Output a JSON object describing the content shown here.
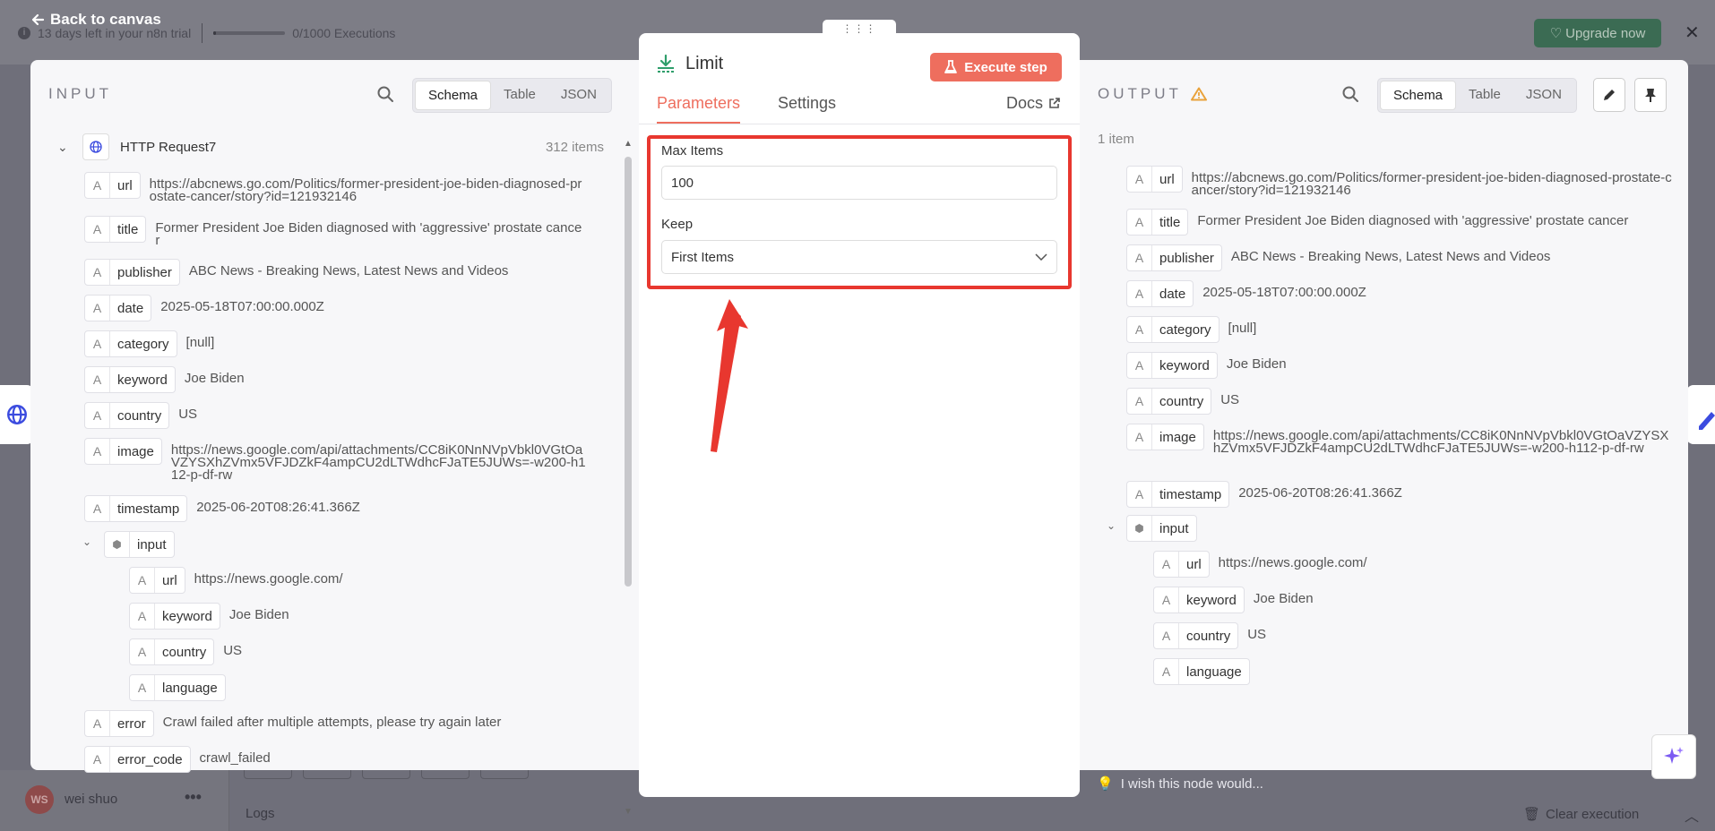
{
  "background": {
    "trial_text": "13 days left in your n8n trial",
    "executions_text": "0/1000 Executions",
    "executions_progress": 0.0,
    "upgrade_label": "Upgrade now",
    "username": "wei shuo",
    "avatar_initials": "WS",
    "logs_label": "Logs",
    "clear_execution_label": "Clear execution"
  },
  "back_link": "Back to canvas",
  "input": {
    "title": "INPUT",
    "view_tabs": [
      "Schema",
      "Table",
      "JSON"
    ],
    "active_tab": "Schema",
    "node_name": "HTTP Request7",
    "item_count": "312 items",
    "fields": [
      {
        "key": "url",
        "value": "https://abcnews.go.com/Politics/former-president-joe-biden-diagnosed-prostate-cancer/story?id=121932146"
      },
      {
        "key": "title",
        "value": "Former President Joe Biden diagnosed with 'aggressive' prostate cancer"
      },
      {
        "key": "publisher",
        "value": "ABC News - Breaking News, Latest News and Videos"
      },
      {
        "key": "date",
        "value": "2025-05-18T07:00:00.000Z"
      },
      {
        "key": "category",
        "value": "[null]"
      },
      {
        "key": "keyword",
        "value": "Joe Biden"
      },
      {
        "key": "country",
        "value": "US"
      },
      {
        "key": "image",
        "value": "https://news.google.com/api/attachments/CC8iK0NnNVpVbkl0VGtOaVZYSXhZVmx5VFJDZkF4ampCU2dLTWdhcFJaTE5JUWs=-w200-h112-p-df-rw"
      },
      {
        "key": "timestamp",
        "value": "2025-06-20T08:26:41.366Z"
      },
      {
        "key": "input",
        "value": ""
      },
      {
        "key": "url",
        "value": "https://news.google.com/"
      },
      {
        "key": "keyword",
        "value": "Joe Biden"
      },
      {
        "key": "country",
        "value": "US"
      },
      {
        "key": "language",
        "value": ""
      },
      {
        "key": "error",
        "value": "Crawl failed after multiple attempts, please try again later"
      },
      {
        "key": "error_code",
        "value": "crawl_failed"
      }
    ]
  },
  "node": {
    "title": "Limit",
    "execute_label": "Execute step",
    "tabs": {
      "parameters": "Parameters",
      "settings": "Settings",
      "docs": "Docs"
    },
    "max_items_label": "Max Items",
    "max_items_value": "100",
    "keep_label": "Keep",
    "keep_value": "First Items"
  },
  "output": {
    "title": "OUTPUT",
    "view_tabs": [
      "Schema",
      "Table",
      "JSON"
    ],
    "active_tab": "Schema",
    "item_count": "1 item",
    "fields": [
      {
        "key": "url",
        "value": "https://abcnews.go.com/Politics/former-president-joe-biden-diagnosed-prostate-cancer/story?id=121932146"
      },
      {
        "key": "title",
        "value": "Former President Joe Biden diagnosed with 'aggressive' prostate cancer"
      },
      {
        "key": "publisher",
        "value": "ABC News - Breaking News, Latest News and Videos"
      },
      {
        "key": "date",
        "value": "2025-05-18T07:00:00.000Z"
      },
      {
        "key": "category",
        "value": "[null]"
      },
      {
        "key": "keyword",
        "value": "Joe Biden"
      },
      {
        "key": "country",
        "value": "US"
      },
      {
        "key": "image",
        "value": "https://news.google.com/api/attachments/CC8iK0NnNVpVbkl0VGtOaVZYSXhZVmx5VFJDZkF4ampCU2dLTWdhcFJaTE5JUWs=-w200-h112-p-df-rw"
      },
      {
        "key": "timestamp",
        "value": "2025-06-20T08:26:41.366Z"
      },
      {
        "key": "input",
        "value": ""
      },
      {
        "key": "url",
        "value": "https://news.google.com/"
      },
      {
        "key": "keyword",
        "value": "Joe Biden"
      },
      {
        "key": "country",
        "value": "US"
      },
      {
        "key": "language",
        "value": ""
      }
    ],
    "wish_text": "I wish this node would..."
  },
  "colors": {
    "accent": "#ee6e5e",
    "highlight_red": "#e8372f",
    "upgrade_green": "#3b6b53"
  }
}
